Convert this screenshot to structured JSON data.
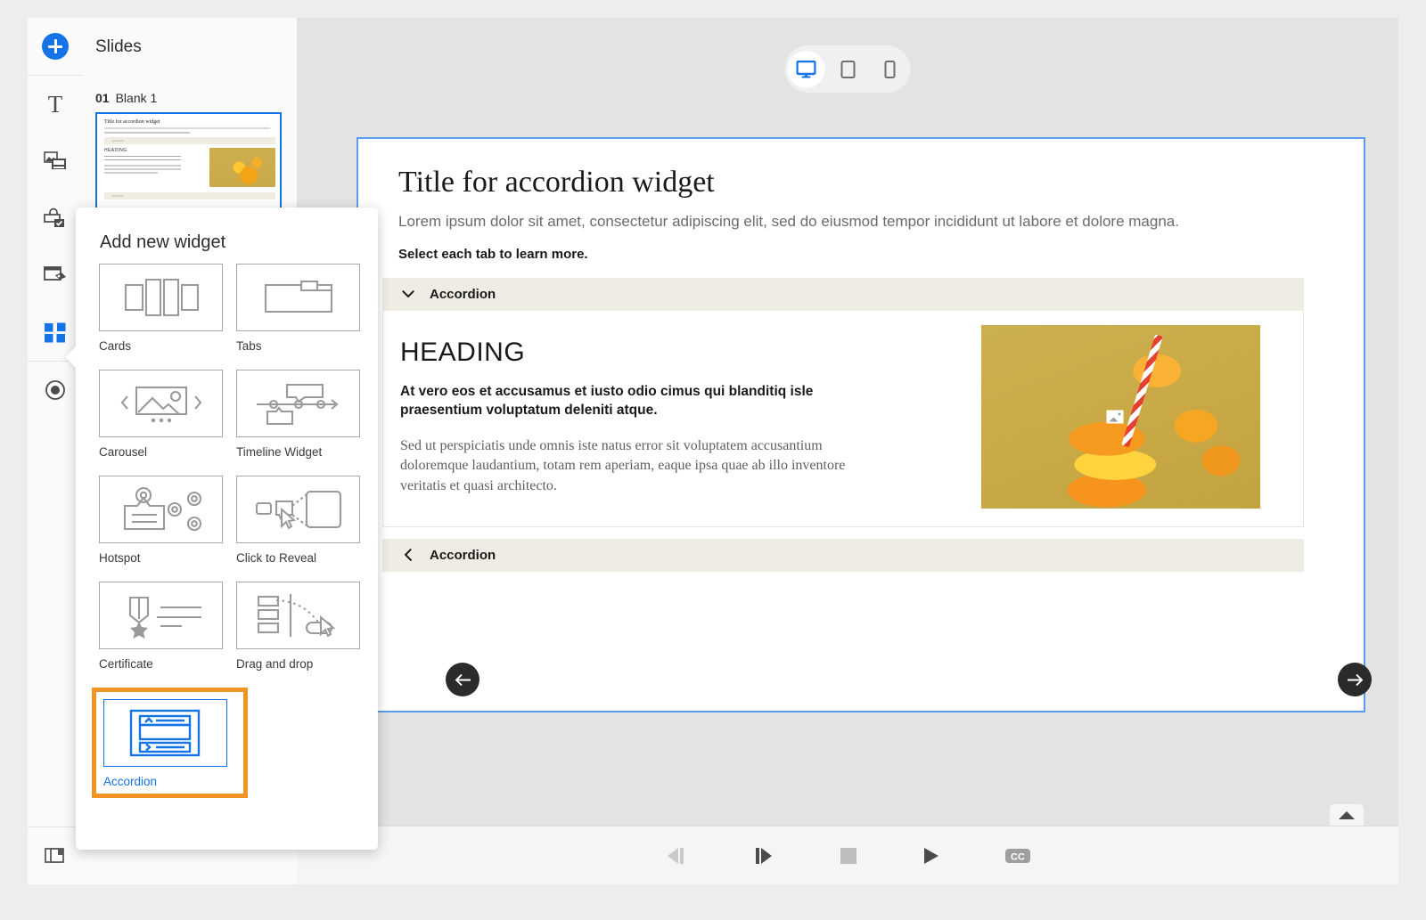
{
  "rail": {
    "items": [
      {
        "name": "add-button",
        "icon": "plus-circle-icon",
        "label": "Add"
      },
      {
        "name": "text-tool",
        "icon": "text-icon",
        "label": "T"
      },
      {
        "name": "media-tool",
        "icon": "media-icon",
        "label": "Media"
      },
      {
        "name": "interactions-tool",
        "icon": "interaction-icon",
        "label": "Interactions"
      },
      {
        "name": "states-tool",
        "icon": "states-icon",
        "label": "States"
      },
      {
        "name": "widgets-tool",
        "icon": "widgets-icon",
        "label": "Widgets"
      },
      {
        "name": "record-tool",
        "icon": "record-icon",
        "label": "Record"
      }
    ],
    "bottom_item": {
      "name": "pages-tool",
      "icon": "pages-icon",
      "label": "Pages"
    }
  },
  "slides_panel": {
    "title": "Slides",
    "slide": {
      "number": "01",
      "name": "Blank 1",
      "thumb": {
        "title": "Title for accordion widget",
        "heading": "HEADING",
        "accordion_label": "accordion"
      }
    }
  },
  "device_bar": {
    "devices": [
      {
        "name": "desktop",
        "icon": "desktop-icon",
        "selected": true
      },
      {
        "name": "tablet",
        "icon": "tablet-icon",
        "selected": false
      },
      {
        "name": "mobile",
        "icon": "mobile-icon",
        "selected": false
      }
    ]
  },
  "slide": {
    "title": "Title for accordion widget",
    "subtitle": "Lorem ipsum dolor sit amet, consectetur adipiscing elit, sed do eiusmod tempor incididunt ut labore et dolore magna.",
    "instruction": "Select each tab to learn more.",
    "accordions": [
      {
        "label": "Accordion",
        "expanded": true,
        "chevron": "chevron-down-icon",
        "heading": "HEADING",
        "bold_text": "At vero eos et accusamus et iusto odio cimus qui blanditiq isle praesentium voluptatum deleniti atque.",
        "body_text": "Sed ut perspiciatis unde omnis iste natus error sit voluptatem accusantium doloremque laudantium, totam rem aperiam, eaque ipsa quae ab illo inventore veritatis et quasi architecto.",
        "image_alt": "orange-slices-with-straw"
      },
      {
        "label": "Accordion",
        "expanded": false,
        "chevron": "chevron-right-icon"
      }
    ],
    "nav": {
      "prev": "previous-slide-arrow",
      "next": "next-slide-arrow"
    }
  },
  "playback": {
    "buttons": [
      {
        "name": "previous-frame",
        "icon": "step-backward-icon",
        "enabled": false
      },
      {
        "name": "next-frame",
        "icon": "step-forward-icon",
        "enabled": true
      },
      {
        "name": "stop",
        "icon": "stop-icon",
        "enabled": false
      },
      {
        "name": "play",
        "icon": "play-icon",
        "enabled": true
      },
      {
        "name": "closed-captions",
        "icon": "cc-icon",
        "label": "CC",
        "enabled": true
      }
    ],
    "expand_tab": "timeline-expand-icon"
  },
  "widget_popup": {
    "heading": "Add new widget",
    "widgets": [
      {
        "label": "Cards",
        "icon": "cards-icon",
        "selected": false
      },
      {
        "label": "Tabs",
        "icon": "tabs-icon",
        "selected": false
      },
      {
        "label": "Carousel",
        "icon": "carousel-icon",
        "selected": false
      },
      {
        "label": "Timeline Widget",
        "icon": "timeline-icon",
        "selected": false
      },
      {
        "label": "Hotspot",
        "icon": "hotspot-icon",
        "selected": false
      },
      {
        "label": "Click to Reveal",
        "icon": "click-to-reveal-icon",
        "selected": false
      },
      {
        "label": "Certificate",
        "icon": "certificate-icon",
        "selected": false
      },
      {
        "label": "Drag and drop",
        "icon": "drag-and-drop-icon",
        "selected": false
      },
      {
        "label": "Accordion",
        "icon": "accordion-icon",
        "selected": true
      }
    ]
  },
  "colors": {
    "accent_blue": "#1473e6",
    "selection_orange": "#f29423",
    "accordion_header_bg": "#efece3",
    "canvas_bg": "#e3e3e3"
  }
}
